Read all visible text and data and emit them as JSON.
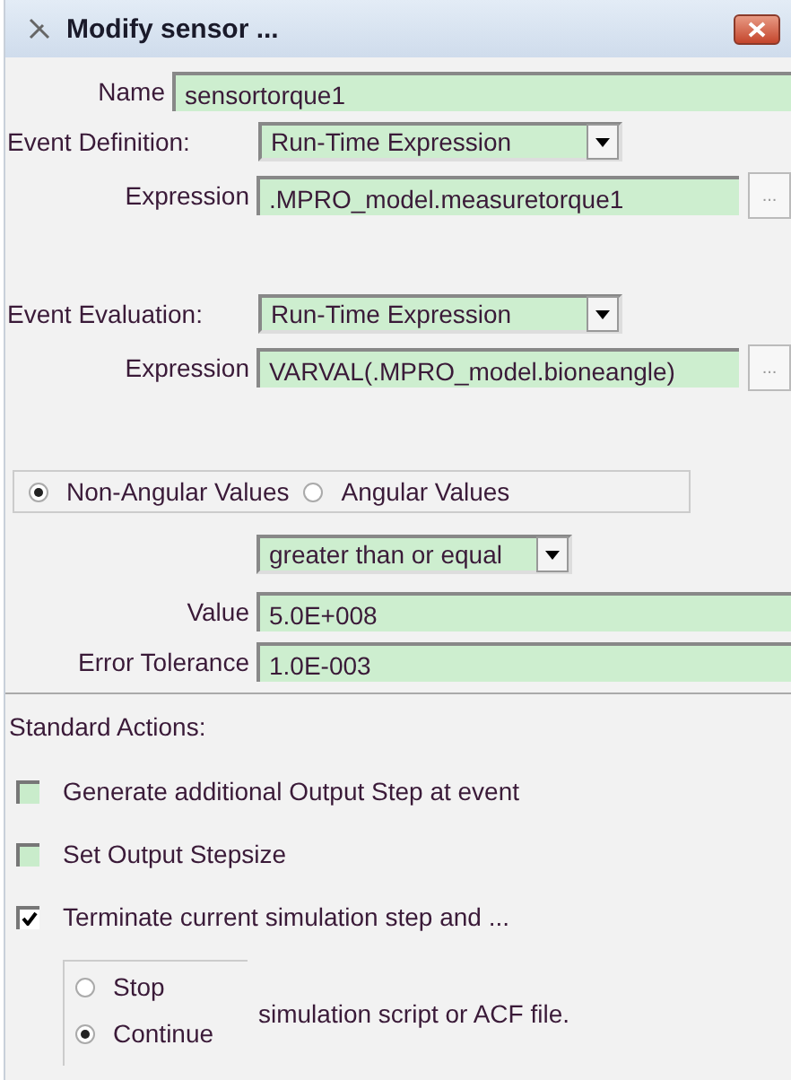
{
  "window": {
    "title": "Modify sensor ..."
  },
  "name": {
    "label": "Name",
    "value": "sensortorque1"
  },
  "event_definition": {
    "label": "Event Definition:",
    "value": "Run-Time Expression",
    "expression_label": "Expression",
    "expression": ".MPRO_model.measuretorque1",
    "browse": "..."
  },
  "event_evaluation": {
    "label": "Event Evaluation:",
    "value": "Run-Time Expression",
    "expression_label": "Expression",
    "expression": "VARVAL(.MPRO_model.bioneangle)",
    "browse": "..."
  },
  "value_type": [
    {
      "label": "Non-Angular Values",
      "selected": true
    },
    {
      "label": "Angular Values",
      "selected": false
    }
  ],
  "comparison": {
    "value": "greater than or equal"
  },
  "value": {
    "label": "Value",
    "value": "5.0E+008"
  },
  "error_tolerance": {
    "label": "Error Tolerance",
    "value": "1.0E-003"
  },
  "standard_actions": {
    "title": "Standard Actions:",
    "items": [
      {
        "label": "Generate additional Output Step at event",
        "checked": false
      },
      {
        "label": "Set Output Stepsize",
        "checked": false
      },
      {
        "label": "Terminate current simulation step and ...",
        "checked": true
      }
    ]
  },
  "termination": {
    "options": [
      {
        "label": "Stop",
        "selected": false
      },
      {
        "label": "Continue",
        "selected": true
      }
    ],
    "suffix": "simulation script or ACF file."
  }
}
